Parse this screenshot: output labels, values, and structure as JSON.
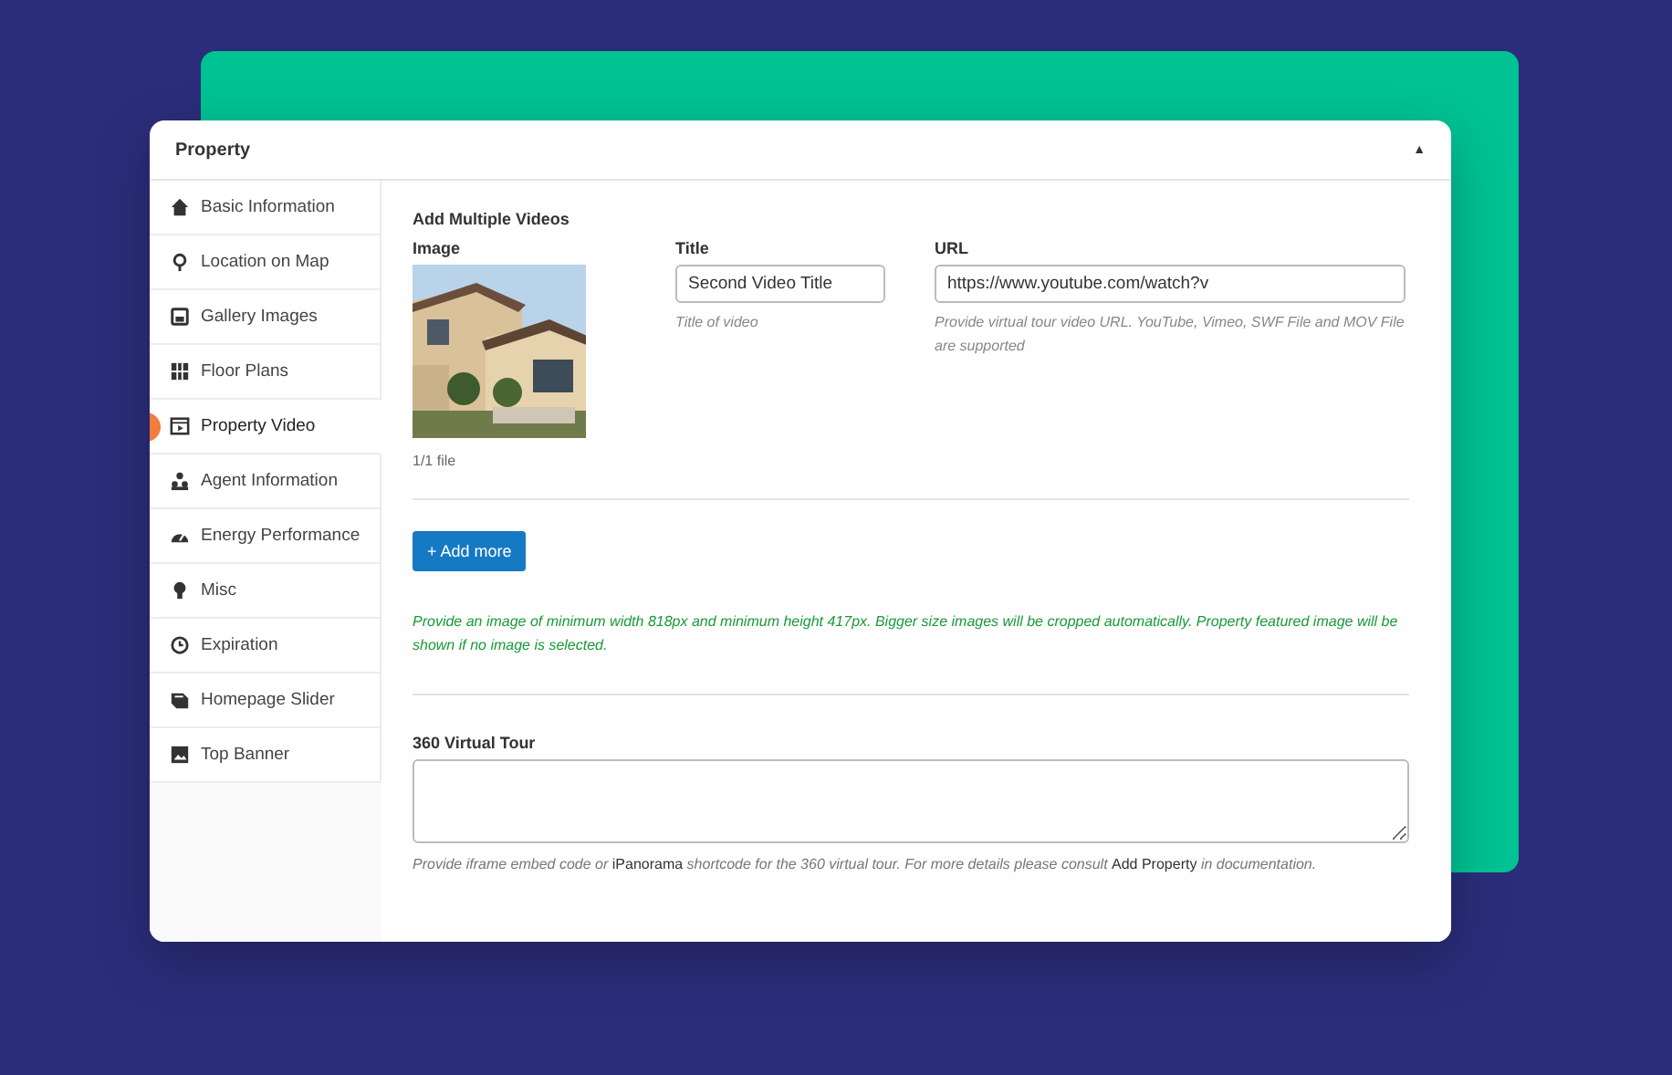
{
  "panel": {
    "title": "Property",
    "toggle": "▲"
  },
  "sidebar": {
    "items": [
      {
        "label": "Basic Information",
        "kind": "home",
        "selected": false
      },
      {
        "label": "Location on Map",
        "kind": "pin",
        "selected": false
      },
      {
        "label": "Gallery Images",
        "kind": "gallery",
        "selected": false
      },
      {
        "label": "Floor Plans",
        "kind": "grid",
        "selected": false
      },
      {
        "label": "Property Video",
        "kind": "video",
        "selected": true
      },
      {
        "label": "Agent Information",
        "kind": "people",
        "selected": false
      },
      {
        "label": "Energy Performance",
        "kind": "gauge",
        "selected": false
      },
      {
        "label": "Misc",
        "kind": "bulb",
        "selected": false
      },
      {
        "label": "Expiration",
        "kind": "clock",
        "selected": false
      },
      {
        "label": "Homepage Slider",
        "kind": "slider",
        "selected": false
      },
      {
        "label": "Top Banner",
        "kind": "banner",
        "selected": false
      }
    ]
  },
  "videos": {
    "heading": "Add Multiple Videos",
    "image": {
      "label": "Image",
      "count": "1/1 file"
    },
    "title": {
      "label": "Title",
      "value": "Second Video Title",
      "hint": "Title of video"
    },
    "url": {
      "label": "URL",
      "value": "https://www.youtube.com/watch?v",
      "hint": "Provide virtual tour video URL. YouTube, Vimeo, SWF File and MOV File are supported"
    },
    "add_button": "+ Add more",
    "notice": "Provide an image of minimum width 818px and minimum height 417px. Bigger size images will be cropped automatically. Property featured image will be shown if no image is selected."
  },
  "virtual_tour": {
    "label": "360 Virtual Tour",
    "help": "Provide iframe embed code or **iPanorama** shortcode for the 360 virtual tour. For more details please consult **Add Property** in documentation."
  }
}
